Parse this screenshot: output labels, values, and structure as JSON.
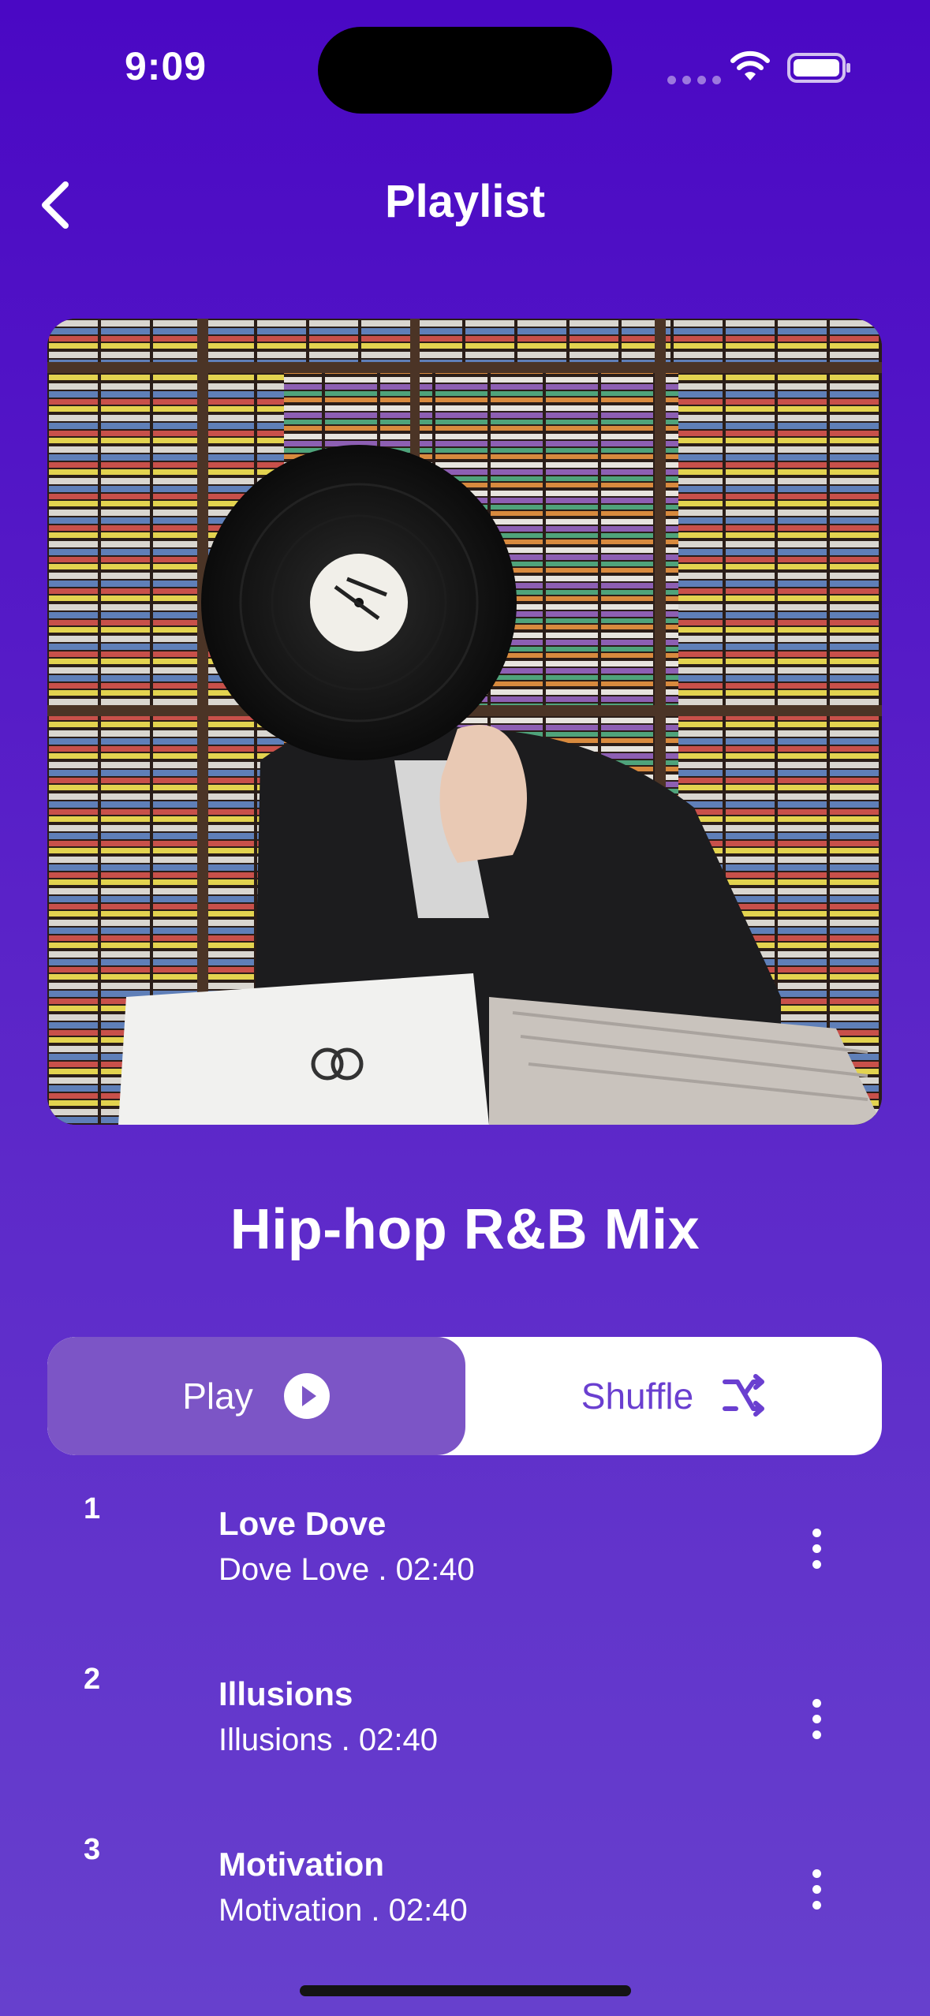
{
  "status_bar": {
    "time": "9:09"
  },
  "header": {
    "title": "Playlist",
    "back_icon": "chevron-left-icon"
  },
  "playlist": {
    "title": "Hip-hop R&B Mix"
  },
  "controls": {
    "play_label": "Play",
    "play_icon": "play-circle-icon",
    "shuffle_label": "Shuffle",
    "shuffle_icon": "shuffle-icon"
  },
  "tracks": [
    {
      "number": "1",
      "title": "Love Dove",
      "subtitle": "Dove Love . 02:40"
    },
    {
      "number": "2",
      "title": "Illusions",
      "subtitle": "Illusions . 02:40"
    },
    {
      "number": "3",
      "title": "Motivation",
      "subtitle": "Motivation . 02:40"
    }
  ],
  "colors": {
    "background_top": "#4a08c4",
    "background_bottom": "#6740cd",
    "play_button": "#7c55c6",
    "shuffle_text": "#6a3fd0"
  }
}
